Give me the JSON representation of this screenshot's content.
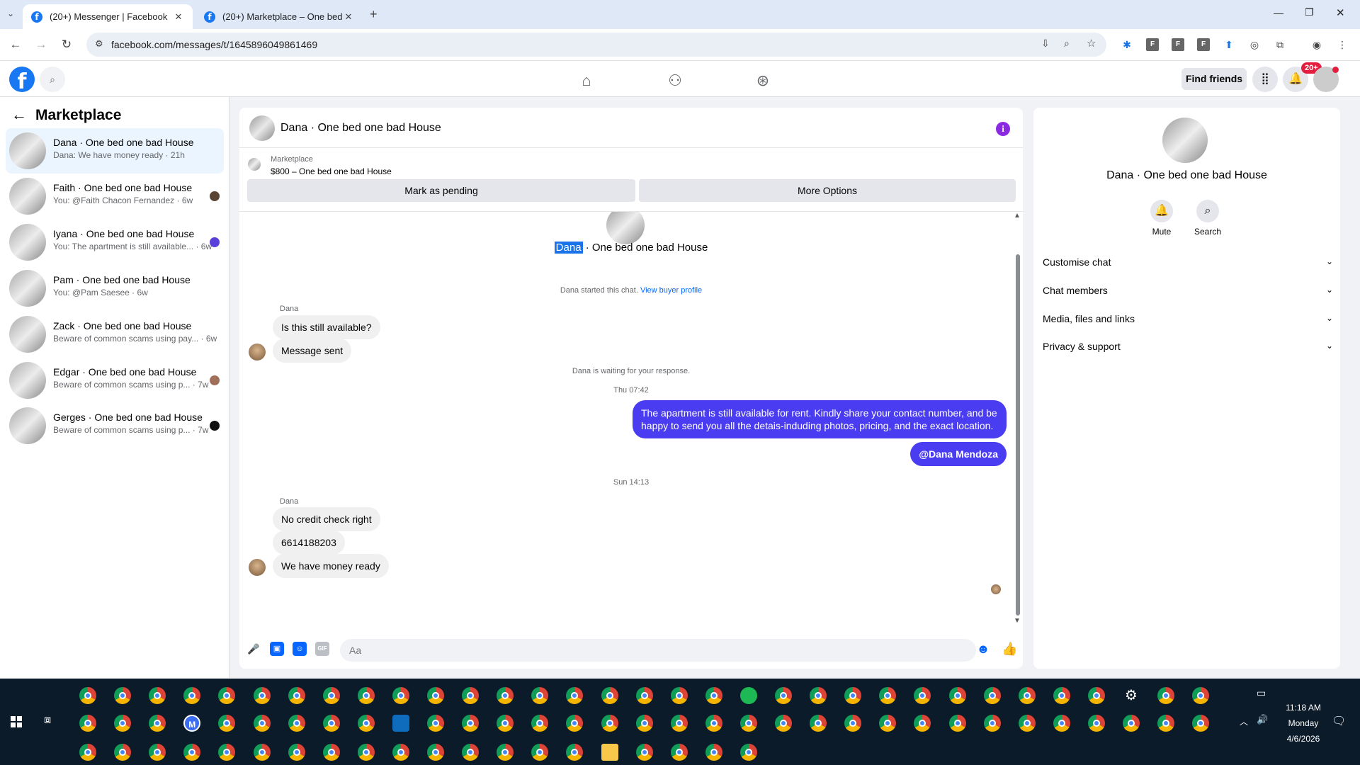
{
  "browser": {
    "tabs": [
      {
        "label": "(20+) Messenger | Facebook",
        "active": true
      },
      {
        "label": "(20+) Marketplace – One bed o",
        "active": false
      }
    ],
    "url": "facebook.com/messages/t/1645896049861469",
    "ext_letters": [
      "F",
      "F",
      "F"
    ]
  },
  "fb_header": {
    "find_friends_label": "Find friends",
    "notif_count": "20+"
  },
  "sidebar": {
    "title": "Marketplace",
    "conversations": [
      {
        "name": "Dana · One bed one bad House",
        "preview": "Dana: We have money ready · 21h",
        "selected": true
      },
      {
        "name": "Faith · One bed one bad House",
        "preview": "You: @Faith Chacon Fernandez · 6w"
      },
      {
        "name": "Iyana · One bed one bad House",
        "preview": "You: The apartment is still available... · 6w"
      },
      {
        "name": "Pam · One bed one bad House",
        "preview": "You: @Pam Saesee · 6w"
      },
      {
        "name": "Zack · One bed one bad House",
        "preview": "Beware of common scams using pay... · 6w"
      },
      {
        "name": "Edgar · One bed one bad House",
        "preview": "Beware of common scams using p... · 7w"
      },
      {
        "name": "Gerges · One bed one bad House",
        "preview": "Beware of common scams using p... · 7w"
      }
    ]
  },
  "chat": {
    "title": "Dana · One bed one bad House",
    "marketplace_label": "Marketplace",
    "listing": "$800 – One bed one bad House",
    "mark_pending_label": "Mark as pending",
    "more_options_label": "More Options",
    "intro_name_highlight": "Dana",
    "intro_name_rest": " · One bed one bad House",
    "started_text": "Dana started this chat.",
    "view_profile_label": "View buyer profile",
    "sender_1": "Dana",
    "msg_1": "Is this still available?",
    "msg_2": "Message sent",
    "waiting_text": "Dana is waiting for your response.",
    "time_1": "Thu 07:42",
    "my_msg_line1": "The apartment is still available for rent. Kindly share your contact number, and be",
    "my_msg_line2": "happy to send you all the detais-induding photos, pricing, and the exact location.",
    "my_mention": "@Dana Mendoza",
    "time_2": "Sun 14:13",
    "sender_2": "Dana",
    "msg_3": "No credit check right",
    "msg_4": "6614188203",
    "msg_5": "We have money ready",
    "input_placeholder": "Aa"
  },
  "right_panel": {
    "name": "Dana · One bed one bad House",
    "mute_label": "Mute",
    "search_label": "Search",
    "sections": [
      "Customise chat",
      "Chat members",
      "Media, files and links",
      "Privacy & support"
    ]
  },
  "taskbar": {
    "time": "11:18 AM",
    "day": "Monday",
    "date": "4/6/2026"
  },
  "colors": {
    "fb_blue": "#1877f2",
    "my_bubble": "#4a3cf0",
    "selected_convo": "#ebf5ff",
    "taskbar": "#0c1b29"
  }
}
